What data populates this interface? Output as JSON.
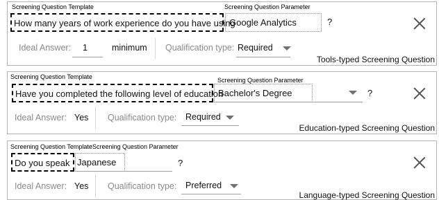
{
  "cards": [
    {
      "template_header": "Screening Question Template",
      "param_header": "Screening Question Parameter",
      "question": "How many years of work experience do you have using",
      "parameter": "Google Analytics",
      "qmark": "?",
      "ideal_label": "Ideal Answer:",
      "ideal_value": "1",
      "ideal_suffix": "minimum",
      "qual_label": "Qualification type:",
      "qual_value": "Required",
      "title": "Tools-typed Screening Question"
    },
    {
      "template_header": "Screening Question Template",
      "param_header": "Screening Question Parameter",
      "question": "Have you completed the following level of education",
      "parameter": "Bachelor's Degree",
      "qmark": "?",
      "ideal_label": "Ideal Answer:",
      "ideal_value": "Yes",
      "qual_label": "Qualification type:",
      "qual_value": "Required",
      "title": "Education-typed Screening Question"
    },
    {
      "template_header": "Screening Question Template",
      "param_header": "Screening Question Parameter",
      "question": "Do you speak",
      "parameter": "Japanese",
      "qmark": "?",
      "ideal_label": "Ideal Answer:",
      "ideal_value": "Yes",
      "qual_label": "Qualification type:",
      "qual_value": "Preferred",
      "title": "Language-typed Screening Question"
    }
  ]
}
